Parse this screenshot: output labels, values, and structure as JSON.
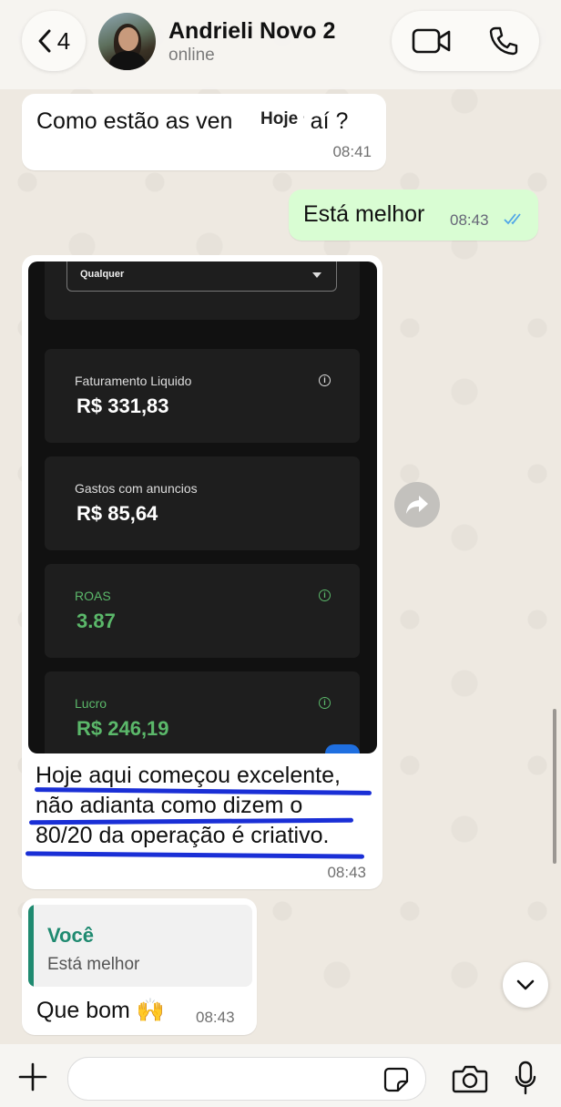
{
  "header": {
    "back_count": "4",
    "contact_name": "Andrieli Novo 2",
    "status": "online"
  },
  "date_chip": "Hoje",
  "messages": {
    "m1": {
      "text": "Como estão as ven",
      "text_end": "r aí ?",
      "time": "08:41"
    },
    "m2": {
      "text": "Está melhor",
      "time": "08:43"
    },
    "m3": {
      "screenshot": {
        "dropdown_value": "Qualquer",
        "stats": [
          {
            "label": "Faturamento Liquido",
            "value": "R$ 331,83"
          },
          {
            "label": "Gastos com anuncios",
            "value": "R$ 85,64"
          },
          {
            "label": "ROAS",
            "value": "3.87"
          },
          {
            "label": "Lucro",
            "value": "R$ 246,19"
          }
        ]
      },
      "caption_lines": [
        "Hoje aqui começou excelente,",
        "não adianta como dizem o",
        "80/20 da operação é criativo."
      ],
      "time": "08:43"
    },
    "m4": {
      "quote_author": "Você",
      "quote_text": "Está melhor",
      "text": "Que bom 🙌",
      "time": "08:43"
    }
  },
  "colors": {
    "outgoing_bubble": "#d9fdd3",
    "read_ticks": "#4fa6e8",
    "quote_accent": "#1f8a70",
    "underline": "#1a2fd6",
    "positive_stat": "#5bb86a"
  },
  "icons": [
    "chevron-left-icon",
    "video-call-icon",
    "phone-icon",
    "forward-icon",
    "chevron-down-icon",
    "plus-icon",
    "sticker-icon",
    "camera-icon",
    "mic-icon",
    "double-check-icon",
    "info-icon"
  ]
}
